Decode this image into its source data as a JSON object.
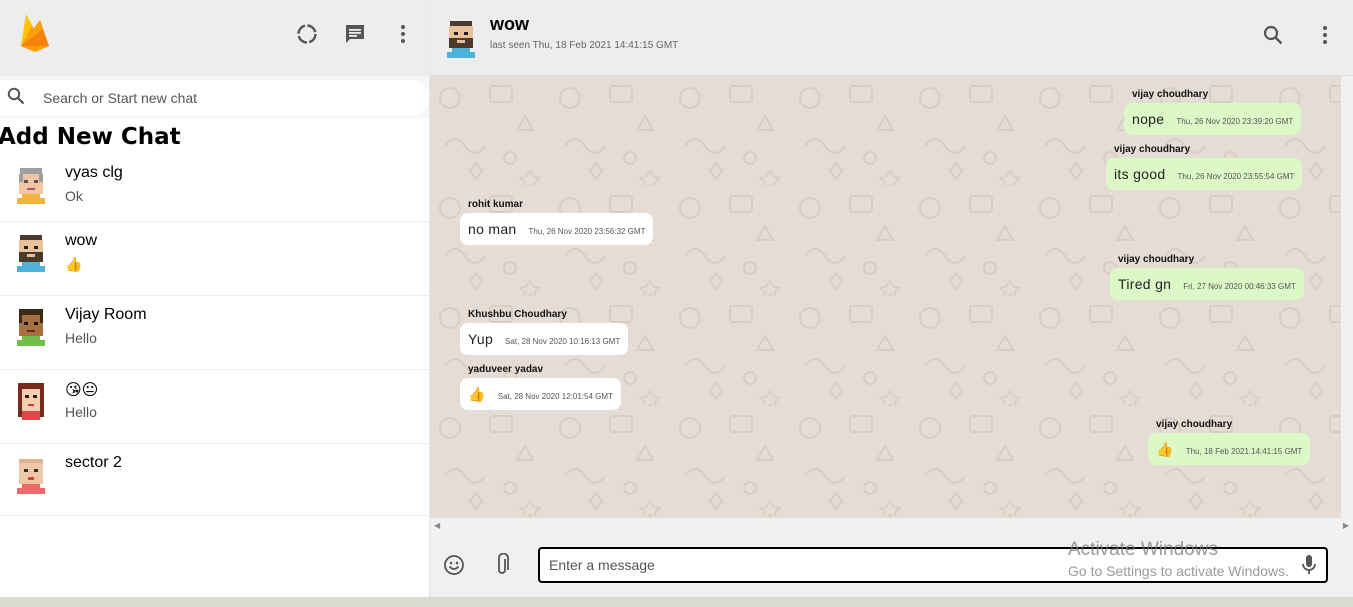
{
  "sidebar": {
    "search_placeholder": "Search or Start new chat",
    "add_chat_label": "Add New Chat",
    "chats": [
      {
        "name": "vyas clg",
        "last": "Ok",
        "avatar": "elder-man-avatar-icon"
      },
      {
        "name": "wow",
        "last": "👍",
        "avatar": "bearded-man-avatar-icon"
      },
      {
        "name": "Vijay Room",
        "last": "Hello",
        "avatar": "curly-man-avatar-icon"
      },
      {
        "name": "😘😐",
        "last": "Hello",
        "avatar": "woman-avatar-icon"
      },
      {
        "name": "sector 2",
        "last": "",
        "avatar": "bald-man-avatar-icon"
      }
    ]
  },
  "chat_header": {
    "name": "wow",
    "last_seen": "last seen Thu, 18 Feb 2021 14:41:15 GMT"
  },
  "messages": [
    {
      "sender": "vijay choudhary",
      "text": "nope",
      "time": "Thu, 26 Nov 2020 23:39:20 GMT",
      "type": "sent"
    },
    {
      "sender": "vijay choudhary",
      "text": "its good",
      "time": "Thu, 26 Nov 2020 23:55:54 GMT",
      "type": "sent"
    },
    {
      "sender": "rohit kumar",
      "text": "no man",
      "time": "Thu, 26 Nov 2020 23:56:32 GMT",
      "type": "received"
    },
    {
      "sender": "vijay choudhary",
      "text": "Tired gn",
      "time": "Fri, 27 Nov 2020 00:46:33 GMT",
      "type": "sent"
    },
    {
      "sender": "Khushbu Choudhary",
      "text": "Yup",
      "time": "Sat, 28 Nov 2020 10:16:13 GMT",
      "type": "received"
    },
    {
      "sender": "yaduveer yadav",
      "text": "👍",
      "time": "Sat, 28 Nov 2020 12:01:54 GMT",
      "type": "received"
    },
    {
      "sender": "vijay choudhary",
      "text": "👍",
      "time": "Thu, 18 Feb 2021 14:41:15 GMT",
      "type": "sent"
    }
  ],
  "composer": {
    "placeholder": "Enter a message"
  },
  "watermark": {
    "line1": "Activate Windows",
    "line2": "Go to Settings to activate Windows."
  },
  "colors": {
    "sent_bubble": "#dcf8c6",
    "received_bubble": "#ffffff",
    "chat_background": "#e5ddd5",
    "header_background": "#ededed",
    "firebase_orange": "#ffa000"
  }
}
